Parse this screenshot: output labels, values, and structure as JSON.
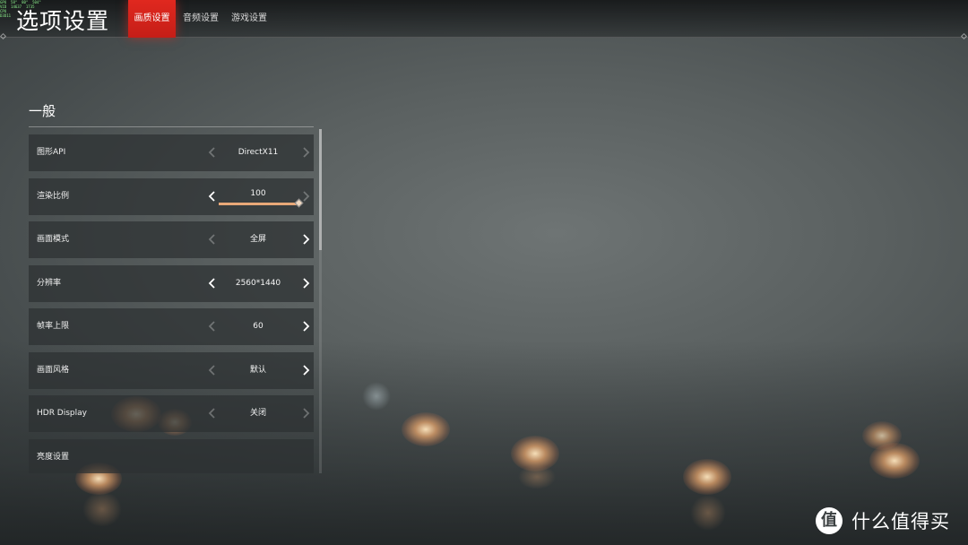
{
  "header": {
    "title": "选项设置",
    "tabs": [
      {
        "label": "画质设置",
        "active": true
      },
      {
        "label": "音频设置",
        "active": false
      },
      {
        "label": "游戏设置",
        "active": false
      }
    ]
  },
  "overlay": {
    "perf_lines": [
      "GPU  58°  80°  504°",
      "VID  14637  1735  ",
      "CPU",
      "D3D11"
    ]
  },
  "section": {
    "title": "一般"
  },
  "settings": [
    {
      "label": "图形API",
      "value": "DirectX11",
      "left_enabled": false,
      "right_enabled": false
    },
    {
      "label": "渲染比例",
      "value": "100",
      "left_enabled": true,
      "right_enabled": false,
      "slider_fraction": 1.0
    },
    {
      "label": "画面模式",
      "value": "全屏",
      "left_enabled": false,
      "right_enabled": true
    },
    {
      "label": "分辨率",
      "value": "2560*1440",
      "left_enabled": true,
      "right_enabled": true
    },
    {
      "label": "帧率上限",
      "value": "60",
      "left_enabled": false,
      "right_enabled": true
    },
    {
      "label": "画面风格",
      "value": "默认",
      "left_enabled": false,
      "right_enabled": true
    },
    {
      "label": "HDR Display",
      "value": "关闭",
      "left_enabled": false,
      "right_enabled": false
    },
    {
      "label": "亮度设置",
      "value": "",
      "left_enabled": false,
      "right_enabled": false
    }
  ],
  "watermark": {
    "logo_glyph": "值",
    "text": "什么值得买"
  },
  "colors": {
    "active_tab": "#d42219",
    "slider_fill": "#e8a878"
  }
}
